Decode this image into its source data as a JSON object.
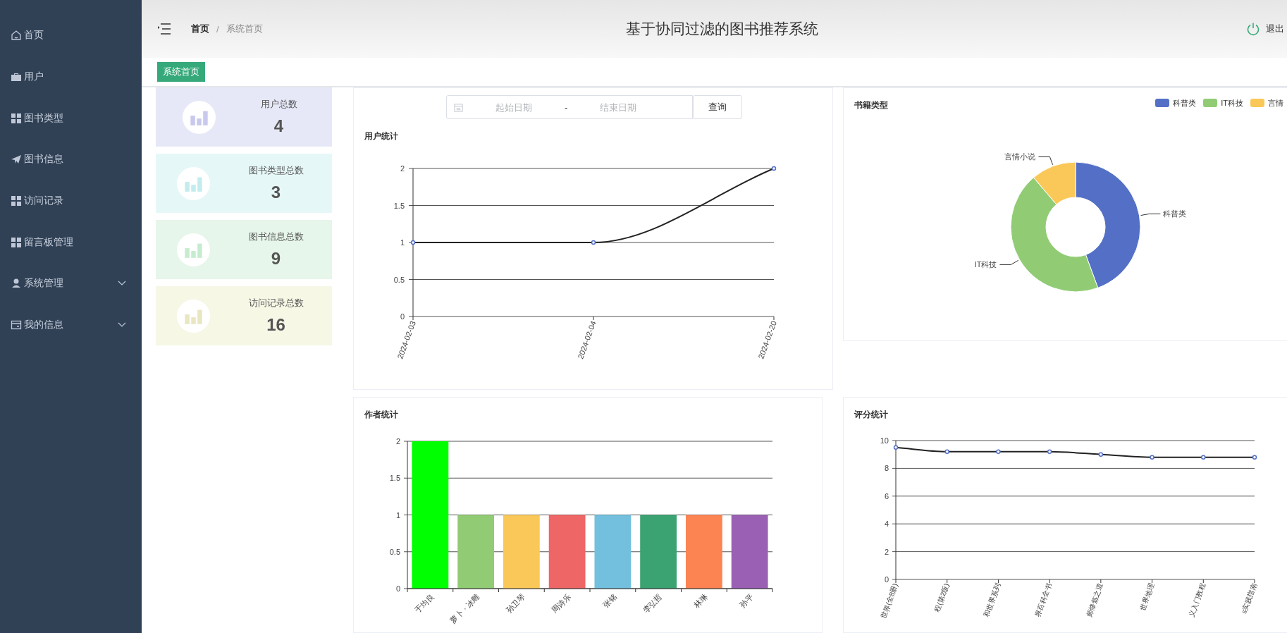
{
  "sidebar": {
    "items": [
      {
        "label": "首页",
        "has_submenu": false
      },
      {
        "label": "用户",
        "has_submenu": false
      },
      {
        "label": "图书类型",
        "has_submenu": false
      },
      {
        "label": "图书信息",
        "has_submenu": false
      },
      {
        "label": "访问记录",
        "has_submenu": false
      },
      {
        "label": "留言板管理",
        "has_submenu": false
      },
      {
        "label": "系统管理",
        "has_submenu": true
      },
      {
        "label": "我的信息",
        "has_submenu": true
      }
    ]
  },
  "header": {
    "breadcrumb": [
      "首页",
      "系统首页"
    ],
    "breadcrumb_separator": "/",
    "title": "基于协同过滤的图书推荐系统",
    "logout": "退出"
  },
  "tabs": [
    {
      "label": "系统首页",
      "selected": true
    }
  ],
  "stats": [
    {
      "label": "用户总数",
      "value": "4",
      "color": "#e6e8f7"
    },
    {
      "label": "图书类型总数",
      "value": "3",
      "color": "#e6f7f7"
    },
    {
      "label": "图书信息总数",
      "value": "9",
      "color": "#e6f6ea"
    },
    {
      "label": "访问记录总数",
      "value": "16",
      "color": "#f7f7e6"
    }
  ],
  "date_range": {
    "start_placeholder": "起始日期",
    "separator": "-",
    "end_placeholder": "结束日期"
  },
  "query_button": "查询",
  "user_chart": {
    "title": "用户统计",
    "chart_data": {
      "type": "line",
      "categories": [
        "2024-02-03",
        "2024-02-04",
        "2024-02-20"
      ],
      "values": [
        1,
        1,
        2
      ],
      "ylim": [
        0,
        2
      ],
      "yticks": [
        0,
        0.5,
        1,
        1.5,
        2
      ],
      "grid": true,
      "marker": true
    }
  },
  "book_type_chart": {
    "title": "书籍类型",
    "legend": [
      {
        "label": "科普类",
        "color": "#5470c6"
      },
      {
        "label": "IT科技",
        "color": "#91cc75"
      },
      {
        "label": "言情",
        "color": "#fac858"
      }
    ],
    "chart_data": {
      "type": "donut",
      "categories": [
        "科普类",
        "IT科技",
        "言情小说"
      ],
      "values": [
        44.4,
        44.4,
        11.2
      ]
    }
  },
  "author_chart": {
    "title": "作者统计",
    "bars": [
      {
        "color": "#00ff00"
      },
      {
        "color": "#91cc75"
      },
      {
        "color": "#fac858"
      },
      {
        "color": "#ee6666"
      },
      {
        "color": "#73c0de"
      },
      {
        "color": "#3ba272"
      },
      {
        "color": "#fc8452"
      },
      {
        "color": "#9a60b4"
      }
    ],
    "chart_data": {
      "type": "bar",
      "categories": [
        "于均良",
        "萝卜 · 冰雕",
        "孙卫琴",
        "周诗乐",
        "张铭",
        "李弘哲",
        "林琳",
        "孙平"
      ],
      "values": [
        2,
        1,
        1,
        1,
        1,
        1,
        1,
        1
      ],
      "ylim": [
        0,
        2
      ],
      "yticks": [
        0,
        0.5,
        1,
        1.5,
        2
      ],
      "grid": true
    }
  },
  "rating_chart": {
    "title": "评分统计",
    "chart_data": {
      "type": "line",
      "categories": [
        "世界(全8册)",
        "程(第2版)",
        "和世界系列",
        "界百科全书",
        "师修炼之道",
        "世界地理",
        "义入门教程",
        "s实践指南"
      ],
      "values": [
        9.5,
        9.2,
        9.2,
        9.2,
        9.0,
        8.8,
        8.8,
        8.8
      ],
      "ylim": [
        0,
        10
      ],
      "yticks": [
        0,
        2,
        4,
        6,
        8,
        10
      ],
      "grid": true,
      "marker": true
    }
  }
}
